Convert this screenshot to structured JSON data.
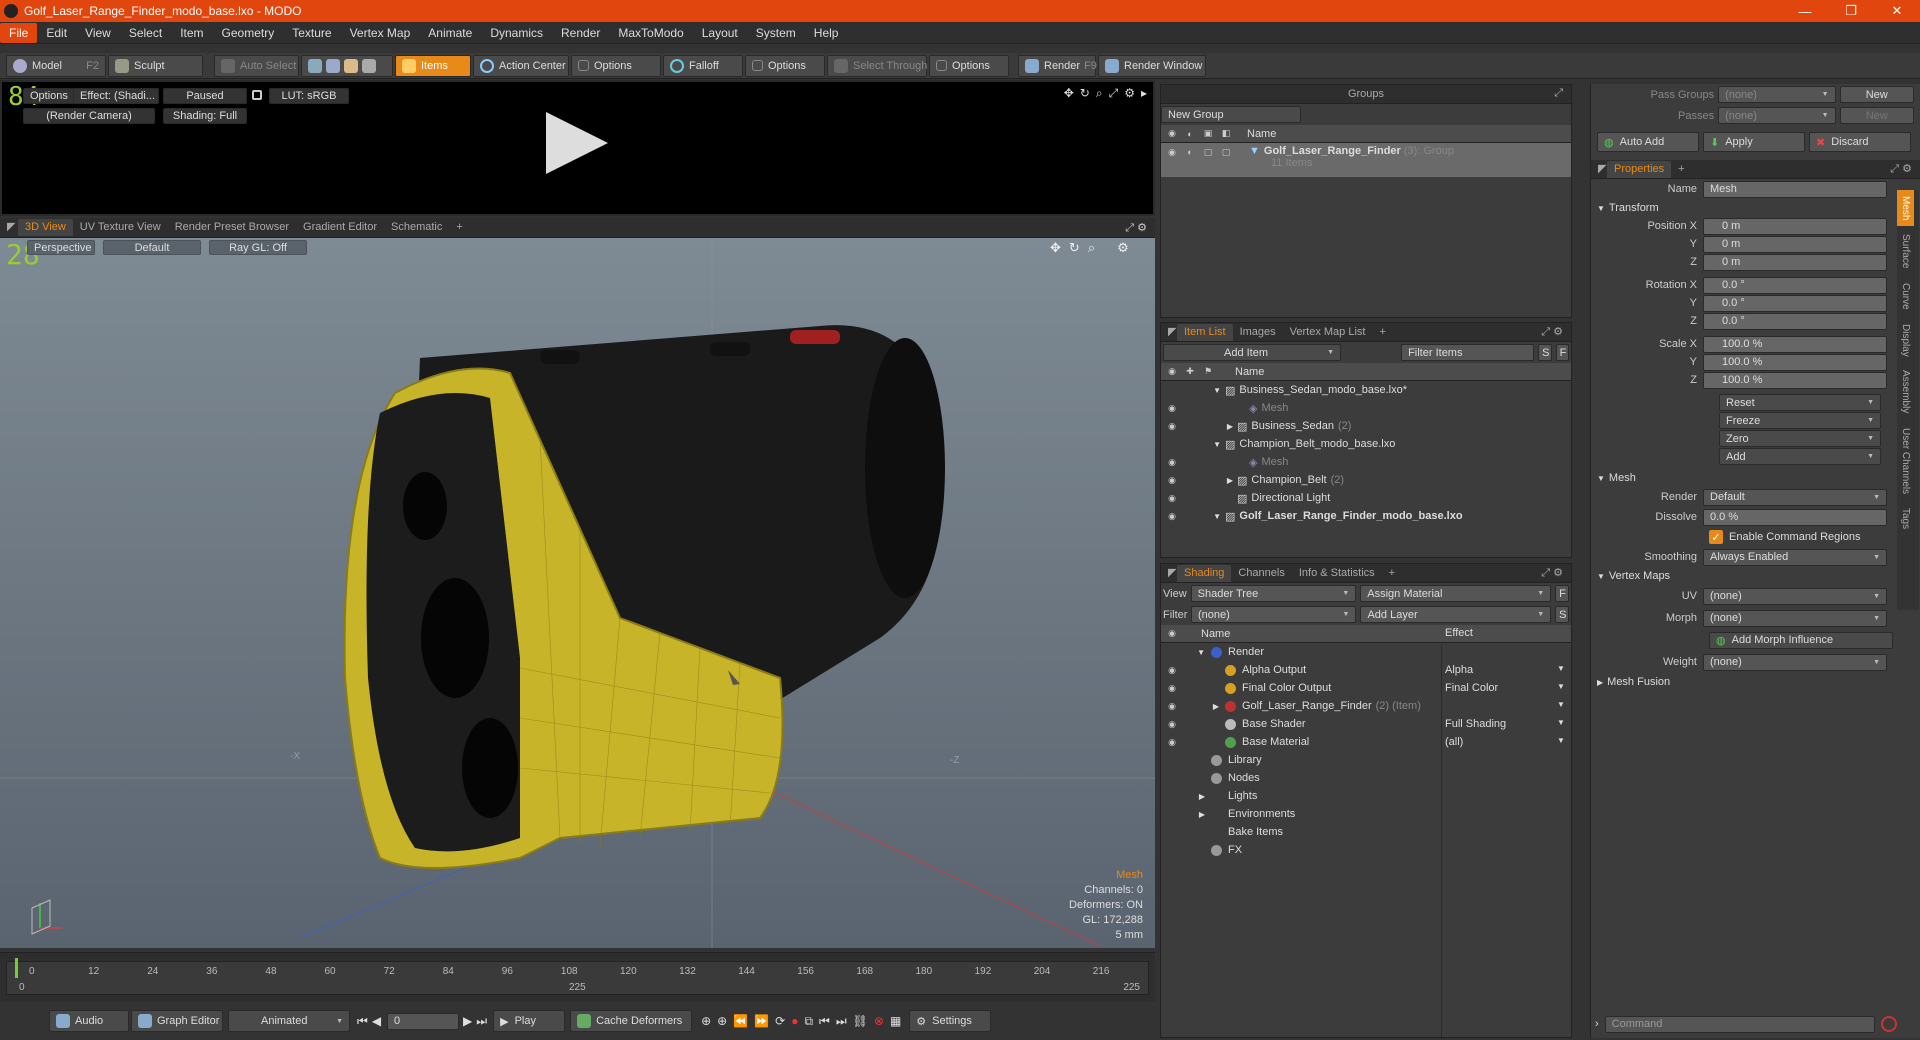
{
  "title": {
    "text": "Golf_Laser_Range_Finder_modo_base.lxo - MODO",
    "minimize": "—",
    "maximize": "❐",
    "close": "✕"
  },
  "menu": [
    "File",
    "Edit",
    "View",
    "Select",
    "Item",
    "Geometry",
    "Texture",
    "Vertex Map",
    "Animate",
    "Dynamics",
    "Render",
    "MaxToModo",
    "Layout",
    "System",
    "Help"
  ],
  "toolbar": {
    "model": "Model",
    "model_key": "F2",
    "sculpt": "Sculpt",
    "auto_select": "Auto Select",
    "items": "Items",
    "action_center": "Action Center",
    "options1": "Options",
    "falloff": "Falloff",
    "options2": "Options",
    "select_through": "Select Through",
    "options3": "Options",
    "render": "Render",
    "render_key": "F9",
    "render_window": "Render Window"
  },
  "preview": {
    "fps": "84",
    "options": "Options",
    "effect": "Effect: (Shadi...",
    "paused": "Paused",
    "lut": "LUT: sRGB",
    "camera": "(Render Camera)",
    "shading": "Shading: Full"
  },
  "viewport": {
    "tabs": [
      "3D View",
      "UV Texture View",
      "Render Preset Browser",
      "Gradient Editor",
      "Schematic"
    ],
    "fps": "28",
    "perspective": "Perspective",
    "default": "Default",
    "raygl": "Ray GL: Off",
    "info_title": "Mesh",
    "channels": "Channels: 0",
    "deformers": "Deformers: ON",
    "gl": "GL: 172,288",
    "size": "5 mm",
    "axis_neg_x": "-X",
    "axis_neg_z": "-Z"
  },
  "timeline": {
    "ticks": [
      "0",
      "12",
      "24",
      "36",
      "48",
      "60",
      "72",
      "84",
      "96",
      "108",
      "120",
      "132",
      "144",
      "156",
      "168",
      "180",
      "192",
      "204",
      "216"
    ],
    "start": "0",
    "end": "225",
    "mid": "225"
  },
  "bottombar": {
    "audio": "Audio",
    "graph_editor": "Graph Editor",
    "animated": "Animated",
    "frame": "0",
    "play": "Play",
    "cache": "Cache Deformers",
    "settings": "Settings"
  },
  "groups": {
    "title": "Groups",
    "new_group": "New Group",
    "col_name": "Name",
    "item_name": "Golf_Laser_Range_Finder",
    "item_count": "(3)",
    "item_type": ": Group",
    "item_sub": "11 Items"
  },
  "itemlist": {
    "tabs": [
      "Item List",
      "Images",
      "Vertex Map List"
    ],
    "add_item": "Add Item",
    "filter": "Filter Items",
    "col_name": "Name",
    "items": [
      {
        "text": "Business_Sedan_modo_base.lxo*",
        "indent": 0,
        "arrow": "▼",
        "bold": false,
        "grey": false
      },
      {
        "text": "Mesh",
        "indent": 2,
        "arrow": "",
        "bold": false,
        "grey": true
      },
      {
        "text": "Business_Sedan",
        "suffix": "(2)",
        "indent": 1,
        "arrow": "▶",
        "bold": false,
        "grey": false
      },
      {
        "text": "Champion_Belt_modo_base.lxo",
        "indent": 0,
        "arrow": "▼",
        "bold": false,
        "grey": false
      },
      {
        "text": "Mesh",
        "indent": 2,
        "arrow": "",
        "bold": false,
        "grey": true
      },
      {
        "text": "Champion_Belt",
        "suffix": "(2)",
        "indent": 1,
        "arrow": "▶",
        "bold": false,
        "grey": false
      },
      {
        "text": "Directional Light",
        "indent": 1,
        "arrow": "",
        "bold": false,
        "grey": false
      },
      {
        "text": "Golf_Laser_Range_Finder_modo_base.lxo",
        "indent": 0,
        "arrow": "▼",
        "bold": true,
        "grey": false
      }
    ]
  },
  "shading": {
    "tabs": [
      "Shading",
      "Channels",
      "Info & Statistics"
    ],
    "view_label": "View",
    "view_value": "Shader Tree",
    "assign": "Assign Material",
    "filter_label": "Filter",
    "filter_value": "(none)",
    "add_layer": "Add Layer",
    "col_name": "Name",
    "col_effect": "Effect",
    "rows": [
      {
        "name": "Render",
        "effect": "",
        "indent": 0,
        "arrow": "▼",
        "color": "#3a5fd0",
        "eye": false
      },
      {
        "name": "Alpha Output",
        "effect": "Alpha",
        "indent": 1,
        "arrow": "",
        "color": "#d8a020",
        "eye": true
      },
      {
        "name": "Final Color Output",
        "effect": "Final Color",
        "indent": 1,
        "arrow": "",
        "color": "#d8a020",
        "eye": true
      },
      {
        "name": "Golf_Laser_Range_Finder",
        "suffix": "(2) (Item)",
        "effect": "",
        "indent": 1,
        "arrow": "▶",
        "color": "#c03030",
        "eye": true
      },
      {
        "name": "Base Shader",
        "effect": "Full Shading",
        "indent": 1,
        "arrow": "",
        "color": "#bbbbbb",
        "eye": true
      },
      {
        "name": "Base Material",
        "effect": "(all)",
        "indent": 1,
        "arrow": "",
        "color": "#50a050",
        "eye": true
      },
      {
        "name": "Library",
        "effect": "",
        "indent": 0,
        "arrow": "",
        "color": "#999999",
        "eye": false
      },
      {
        "name": "Nodes",
        "effect": "",
        "indent": 0,
        "arrow": "",
        "color": "#999999",
        "eye": false
      },
      {
        "name": "Lights",
        "effect": "",
        "indent": 0,
        "arrow": "▶",
        "color": "",
        "eye": false
      },
      {
        "name": "Environments",
        "effect": "",
        "indent": 0,
        "arrow": "▶",
        "color": "",
        "eye": false
      },
      {
        "name": "Bake Items",
        "effect": "",
        "indent": 0,
        "arrow": "",
        "color": "",
        "eye": false
      },
      {
        "name": "FX",
        "effect": "",
        "indent": 0,
        "arrow": "",
        "color": "#999999",
        "eye": false
      }
    ]
  },
  "props": {
    "pass_groups": "Pass Groups",
    "pass_groups_val": "(none)",
    "new": "New",
    "passes": "Passes",
    "passes_val": "(none)",
    "new2": "New",
    "auto_add": "Auto Add",
    "apply": "Apply",
    "discard": "Discard",
    "tab": "Properties",
    "name_label": "Name",
    "name_value": "Mesh",
    "transform": "Transform",
    "position_label": "Position X",
    "pos": [
      "0 m",
      "0 m",
      "0 m"
    ],
    "rotation_label": "Rotation X",
    "rot": [
      "0.0 °",
      "0.0 °",
      "0.0 °"
    ],
    "scale_label": "Scale X",
    "scl": [
      "100.0 %",
      "100.0 %",
      "100.0 %"
    ],
    "y": "Y",
    "z": "Z",
    "reset": "Reset",
    "freeze": "Freeze",
    "zero": "Zero",
    "add": "Add",
    "mesh": "Mesh",
    "render_label": "Render",
    "render_val": "Default",
    "dissolve_label": "Dissolve",
    "dissolve_val": "0.0 %",
    "cmd_regions": "Enable Command Regions",
    "smoothing_label": "Smoothing",
    "smoothing_val": "Always Enabled",
    "vertex_maps": "Vertex Maps",
    "uv_label": "UV",
    "uv_val": "(none)",
    "morph_label": "Morph",
    "morph_val": "(none)",
    "add_morph": "Add Morph Influence",
    "weight_label": "Weight",
    "weight_val": "(none)",
    "mesh_fusion": "Mesh Fusion",
    "command": "Command",
    "sidetabs": [
      "Mesh",
      "Surface",
      "Curve",
      "Display",
      "Assembly",
      "User Channels",
      "Tags"
    ]
  },
  "colors": {
    "accent": "#e88a1a",
    "title": "#e2460f",
    "model_yellow": "#c8b428",
    "model_black": "#1a1a1a"
  }
}
